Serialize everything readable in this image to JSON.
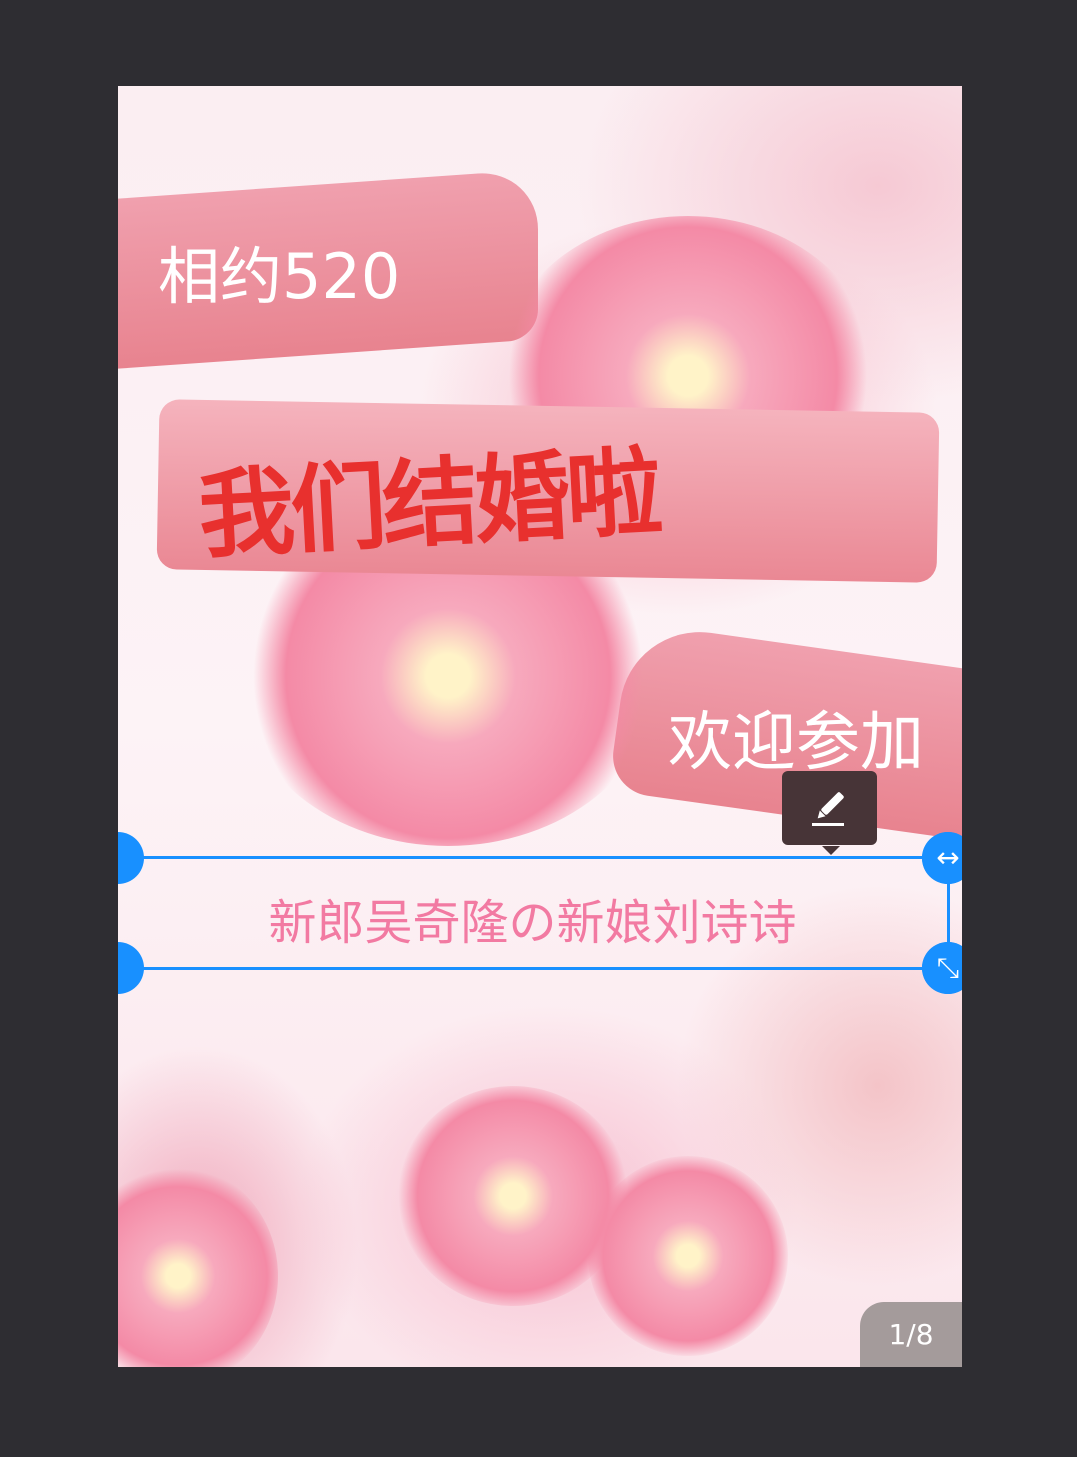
{
  "card": {
    "headline": "相约520",
    "title_art": "我们结婚啦",
    "welcome": "欢迎参加",
    "selected_text": "新郎吴奇隆の新娘刘诗诗"
  },
  "toolbar": {
    "edit_icon": "pencil-icon"
  },
  "handles": {
    "resize_horizontal": "arrow-left-right-icon",
    "resize_diagonal": "arrow-diagonal-icon"
  },
  "pager": {
    "label": "1/8"
  },
  "colors": {
    "background": "#2e2d32",
    "selection": "#1890ff",
    "selected_text": "#f27aa2",
    "title": "#e8302e"
  }
}
